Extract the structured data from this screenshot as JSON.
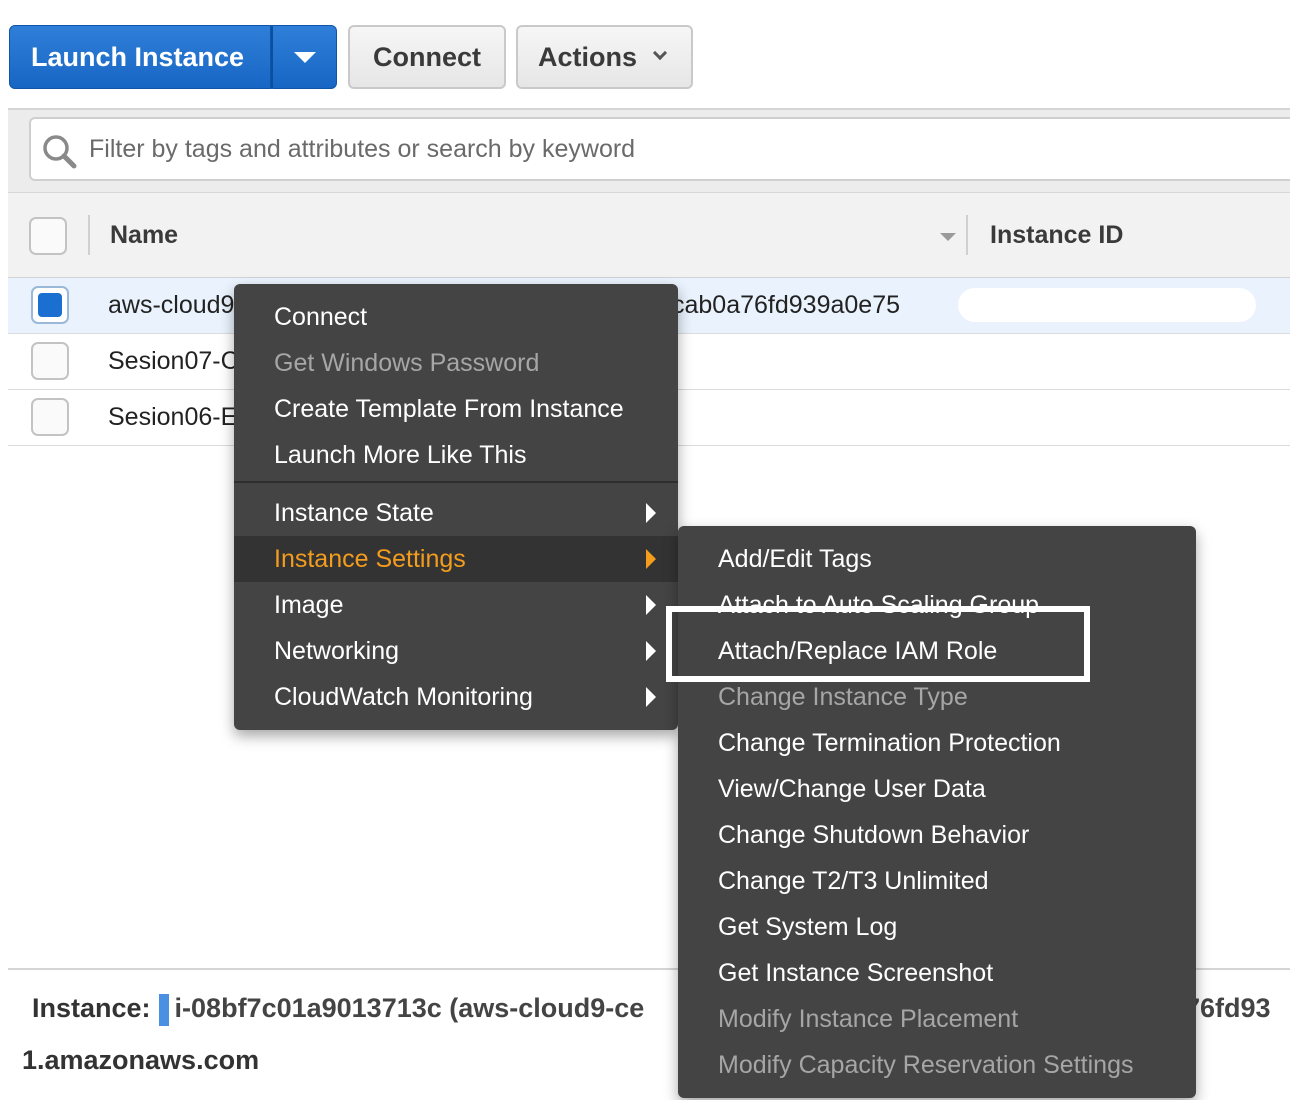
{
  "toolbar": {
    "launch_label": "Launch Instance",
    "connect_label": "Connect",
    "actions_label": "Actions"
  },
  "search": {
    "placeholder": "Filter by tags and attributes or search by keyword"
  },
  "table": {
    "columns": [
      "Name",
      "Instance ID"
    ],
    "rows": [
      {
        "name": "aws-cloud9",
        "instance_id_suffix": "cab0a76fd939a0e75",
        "selected": true
      },
      {
        "name": "Sesion07-C",
        "selected": false
      },
      {
        "name": "Sesion06-E",
        "selected": false
      }
    ]
  },
  "context_menu": {
    "items": [
      {
        "label": "Connect",
        "enabled": true
      },
      {
        "label": "Get Windows Password",
        "enabled": false
      },
      {
        "label": "Create Template From Instance",
        "enabled": true
      },
      {
        "label": "Launch More Like This",
        "enabled": true
      }
    ],
    "submenus": [
      {
        "label": "Instance State"
      },
      {
        "label": "Instance Settings",
        "active": true
      },
      {
        "label": "Image"
      },
      {
        "label": "Networking"
      },
      {
        "label": "CloudWatch Monitoring"
      }
    ]
  },
  "instance_settings_menu": {
    "items": [
      {
        "label": "Add/Edit Tags",
        "enabled": true
      },
      {
        "label": "Attach to Auto Scaling Group",
        "enabled": true
      },
      {
        "label": "Attach/Replace IAM Role",
        "enabled": true,
        "highlighted": true
      },
      {
        "label": "Change Instance Type",
        "enabled": false
      },
      {
        "label": "Change Termination Protection",
        "enabled": true
      },
      {
        "label": "View/Change User Data",
        "enabled": true
      },
      {
        "label": "Change Shutdown Behavior",
        "enabled": true
      },
      {
        "label": "Change T2/T3 Unlimited",
        "enabled": true
      },
      {
        "label": "Get System Log",
        "enabled": true
      },
      {
        "label": "Get Instance Screenshot",
        "enabled": true
      },
      {
        "label": "Modify Instance Placement",
        "enabled": false
      },
      {
        "label": "Modify Capacity Reservation Settings",
        "enabled": false
      }
    ]
  },
  "details": {
    "instance_label": "Instance:",
    "instance_value": "i-08bf7c01a9013713c (aws-cloud9-ce",
    "instance_value_tail": "76fd93",
    "dns_tail": "1.amazonaws.com"
  },
  "colors": {
    "primary": "#1766c4",
    "menu_bg": "#444444",
    "menu_active_text": "#f39c1d",
    "selected_row": "#eaf3fd"
  }
}
